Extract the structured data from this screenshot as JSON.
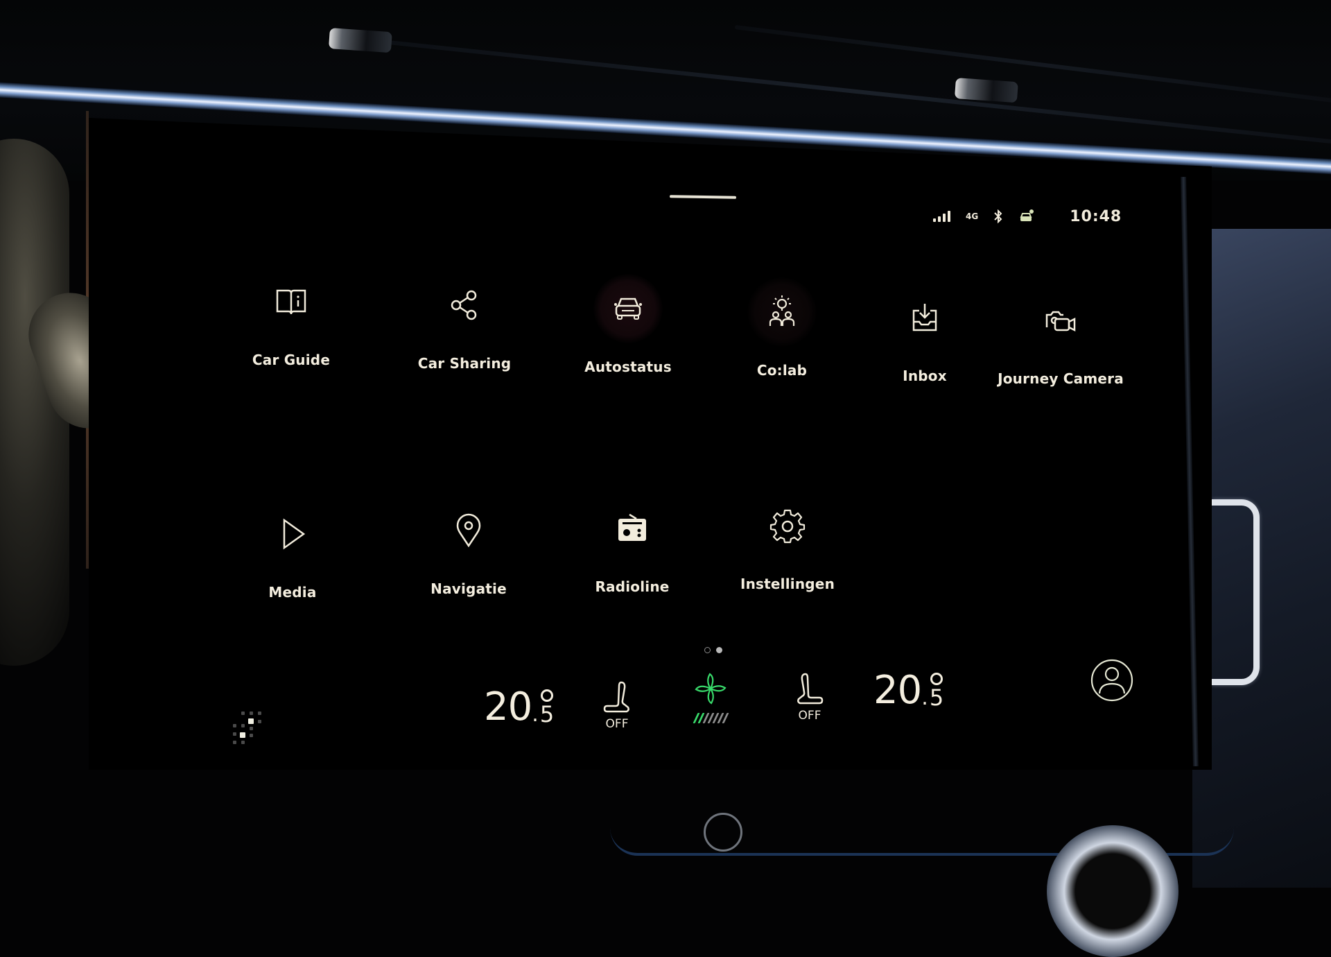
{
  "status_bar": {
    "signal_icon": "cellular-signal-icon",
    "network_type": "4G",
    "bluetooth_icon": "bluetooth-icon",
    "connected_car_icon": "car-connected-icon",
    "time": "10:48"
  },
  "apps": [
    {
      "label": "Car Guide",
      "icon": "book-info-icon"
    },
    {
      "label": "Car Sharing",
      "icon": "share-icon"
    },
    {
      "label": "Autostatus",
      "icon": "car-front-icon"
    },
    {
      "label": "Co:lab",
      "icon": "lightbulb-people-icon"
    },
    {
      "label": "Inbox",
      "icon": "inbox-download-icon"
    },
    {
      "label": "Journey Camera",
      "icon": "camera-video-icon"
    },
    {
      "label": "Media",
      "icon": "play-icon"
    },
    {
      "label": "Navigatie",
      "icon": "map-pin-icon"
    },
    {
      "label": "Radioline",
      "icon": "radio-icon"
    },
    {
      "label": "Instellingen",
      "icon": "gear-icon"
    }
  ],
  "pager": {
    "current_page": 2,
    "total_pages": 2
  },
  "climate": {
    "driver_temp": {
      "whole": "20",
      "fraction": "5"
    },
    "passenger_temp": {
      "whole": "20",
      "fraction": "5"
    },
    "driver_seat_heating": "OFF",
    "passenger_seat_heating": "OFF",
    "fan": {
      "level": 2,
      "max_level": 7,
      "active_color": "#38d96a"
    }
  },
  "profile_icon": "user-profile-icon",
  "colors": {
    "text": "#f2ecdc",
    "background": "#000000",
    "fan_active": "#38d96a"
  }
}
